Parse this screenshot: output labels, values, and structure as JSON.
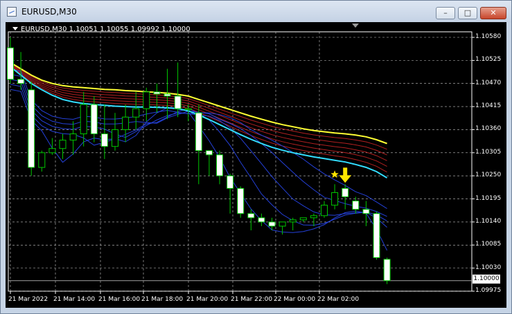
{
  "window": {
    "title": "EURUSD,M30",
    "buttons": {
      "minimize": "–",
      "maximize": "□",
      "close": "✕"
    }
  },
  "chart": {
    "header": "EURUSD,M30  1.10051 1.10055 1.09992 1.10000",
    "current_price": "1.10000",
    "price_labels": [
      "1.10580",
      "1.10525",
      "1.10470",
      "1.10415",
      "1.10360",
      "1.10305",
      "1.10250",
      "1.10195",
      "1.10140",
      "1.10085",
      "1.10030",
      "1.09975"
    ],
    "time_labels": [
      "21 Mar 2022",
      "21 Mar 14:00",
      "21 Mar 16:00",
      "21 Mar 18:00",
      "21 Mar 20:00",
      "21 Mar 22:00",
      "22 Mar 00:00",
      "22 Mar 02:00"
    ],
    "colors": {
      "background": "#000000",
      "grid": "#c8c8c8",
      "candle_bull": "#000000",
      "candle_bear": "#ffffff",
      "wick": "#00c800",
      "ema_fast": "#33ddff",
      "ema_slow": "#ffff33",
      "ribbon_red": "#b02020",
      "ribbon_blue": "#2440d8",
      "arrow": "#ffe600",
      "star": "#ffe600"
    }
  },
  "chart_data": {
    "type": "candlestick",
    "symbol": "EURUSD",
    "timeframe": "M30",
    "ylim": [
      1.09975,
      1.1058
    ],
    "current": {
      "open": 1.10051,
      "high": 1.10055,
      "low": 1.09992,
      "close": 1.1
    },
    "candles": [
      [
        1.10555,
        1.1058,
        1.1047,
        1.1048
      ],
      [
        1.1048,
        1.10545,
        1.10455,
        1.1047
      ],
      [
        1.10455,
        1.10475,
        1.1025,
        1.1027
      ],
      [
        1.1027,
        1.1031,
        1.1026,
        1.10305
      ],
      [
        1.10305,
        1.1034,
        1.103,
        1.10315
      ],
      [
        1.10315,
        1.1035,
        1.1029,
        1.10335
      ],
      [
        1.10335,
        1.1038,
        1.103,
        1.1035
      ],
      [
        1.1035,
        1.1045,
        1.1032,
        1.1042
      ],
      [
        1.1042,
        1.1044,
        1.1033,
        1.1035
      ],
      [
        1.1035,
        1.1042,
        1.1029,
        1.1032
      ],
      [
        1.1032,
        1.104,
        1.1031,
        1.1036
      ],
      [
        1.1036,
        1.1042,
        1.1033,
        1.1039
      ],
      [
        1.1039,
        1.1045,
        1.1036,
        1.1041
      ],
      [
        1.1041,
        1.1046,
        1.1038,
        1.1045
      ],
      [
        1.1045,
        1.1047,
        1.104,
        1.10445
      ],
      [
        1.10445,
        1.10505,
        1.10385,
        1.1044
      ],
      [
        1.1044,
        1.1052,
        1.1039,
        1.1041
      ],
      [
        1.1041,
        1.1042,
        1.1038,
        1.1041
      ],
      [
        1.104,
        1.1042,
        1.1023,
        1.1031
      ],
      [
        1.1031,
        1.1031,
        1.1025,
        1.103
      ],
      [
        1.103,
        1.1031,
        1.1023,
        1.1025
      ],
      [
        1.1025,
        1.10255,
        1.1016,
        1.1022
      ],
      [
        1.1022,
        1.10225,
        1.1015,
        1.1016
      ],
      [
        1.1016,
        1.1017,
        1.1012,
        1.1015
      ],
      [
        1.1015,
        1.1016,
        1.1013,
        1.1014
      ],
      [
        1.1014,
        1.1015,
        1.1012,
        1.1013
      ],
      [
        1.1013,
        1.1014,
        1.1011,
        1.1014
      ],
      [
        1.1014,
        1.1015,
        1.1012,
        1.10145
      ],
      [
        1.10145,
        1.1015,
        1.1014,
        1.1015
      ],
      [
        1.1015,
        1.1016,
        1.1013,
        1.10155
      ],
      [
        1.10155,
        1.1019,
        1.1015,
        1.1018
      ],
      [
        1.1018,
        1.1023,
        1.1017,
        1.1021
      ],
      [
        1.1022,
        1.1023,
        1.1017,
        1.102
      ],
      [
        1.1019,
        1.102,
        1.1016,
        1.1017
      ],
      [
        1.1017,
        1.1019,
        1.1013,
        1.1016
      ],
      [
        1.1016,
        1.10165,
        1.1005,
        1.10055
      ],
      [
        1.10051,
        1.10055,
        1.09992,
        1.1
      ]
    ],
    "series": [
      {
        "values": [
          1.1052,
          1.10505,
          1.1049,
          1.10478,
          1.1047,
          1.10465,
          1.10462,
          1.1046,
          1.10458,
          1.10456,
          1.10455,
          1.10453,
          1.10452,
          1.1045,
          1.10449,
          1.10447,
          1.10444,
          1.1044,
          1.10432,
          1.10424,
          1.10416,
          1.10408,
          1.104,
          1.10392,
          1.10385,
          1.10378,
          1.10372,
          1.10367,
          1.10362,
          1.10358,
          1.10355,
          1.10352,
          1.1035,
          1.10347,
          1.10343,
          1.10336,
          1.10327
        ]
      },
      {
        "values": [
          1.1051,
          1.1049,
          1.1047,
          1.10455,
          1.10442,
          1.10432,
          1.10426,
          1.10422,
          1.1042,
          1.10418,
          1.10416,
          1.10415,
          1.10414,
          1.10414,
          1.10413,
          1.10412,
          1.1041,
          1.10405,
          1.10395,
          1.10384,
          1.10372,
          1.1036,
          1.10348,
          1.10337,
          1.10327,
          1.10318,
          1.10311,
          1.10305,
          1.103,
          1.10295,
          1.10291,
          1.10287,
          1.10283,
          1.10277,
          1.1027,
          1.1026,
          1.10245
        ]
      }
    ],
    "markers": [
      {
        "type": "star",
        "candle": 31
      },
      {
        "type": "down-arrow",
        "candle": 32
      }
    ]
  }
}
